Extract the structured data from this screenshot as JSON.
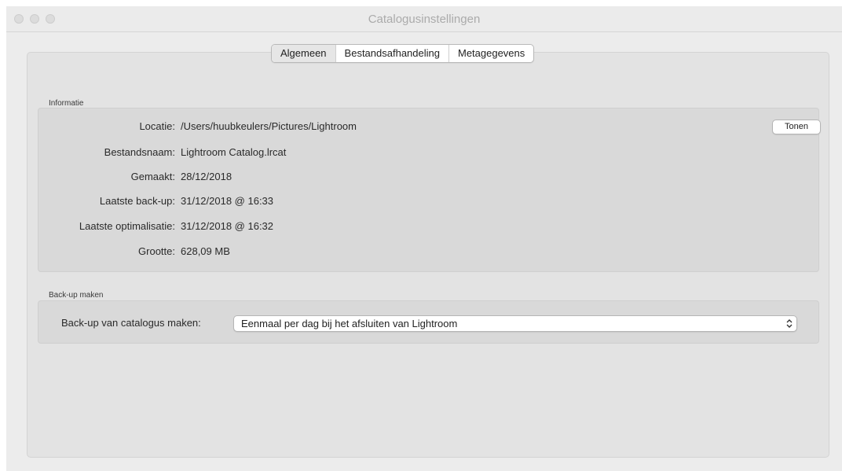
{
  "window": {
    "title": "Catalogusinstellingen"
  },
  "tabs": [
    {
      "label": "Algemeen",
      "active": true
    },
    {
      "label": "Bestandsafhandeling",
      "active": false
    },
    {
      "label": "Metagegevens",
      "active": false
    }
  ],
  "info": {
    "section_label": "Informatie",
    "rows": [
      {
        "label": "Locatie:",
        "value": "/Users/huubkeulers/Pictures/Lightroom"
      },
      {
        "label": "Bestandsnaam:",
        "value": "Lightroom Catalog.lrcat"
      },
      {
        "label": "Gemaakt:",
        "value": "28/12/2018"
      },
      {
        "label": "Laatste back-up:",
        "value": "31/12/2018 @ 16:33"
      },
      {
        "label": "Laatste optimalisatie:",
        "value": "31/12/2018 @ 16:32"
      },
      {
        "label": "Grootte:",
        "value": "628,09 MB"
      }
    ],
    "show_button": "Tonen"
  },
  "backup": {
    "section_label": "Back-up maken",
    "label": "Back-up van catalogus maken:",
    "selected": "Eenmaal per dag bij het afsluiten van Lightroom"
  },
  "icons": {
    "traffic_lights": [
      "close-icon",
      "minimize-icon",
      "zoom-icon"
    ],
    "select_arrows": "up-down-chevron-icon"
  }
}
